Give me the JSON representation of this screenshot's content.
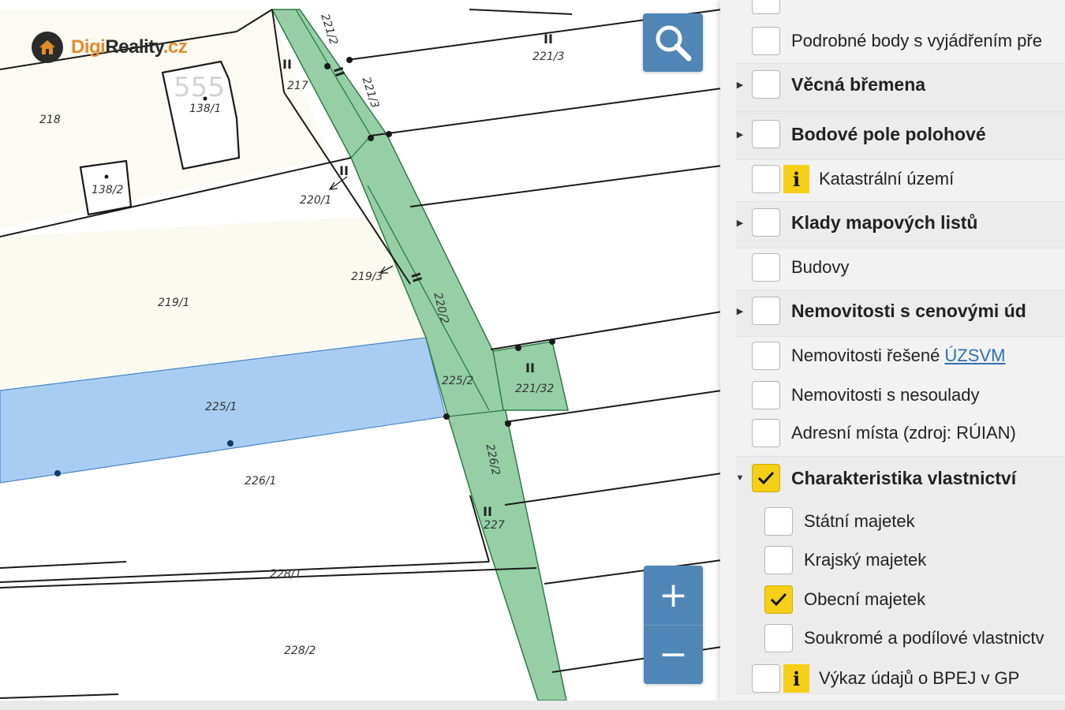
{
  "brand": {
    "part1": "Digi",
    "part2": "Reality",
    "part3": ".cz",
    "accent_color": "#e58c2a"
  },
  "map": {
    "highlight_colors": {
      "municipal_parcel": "#96cfa6",
      "selected_parcel": "#a9cdf2"
    },
    "parcels": [
      {
        "id": "p-221-2",
        "label": "221/2"
      },
      {
        "id": "p-221-3",
        "label": "221/3"
      },
      {
        "id": "p-221-3b",
        "label": "221/3"
      },
      {
        "id": "p-217",
        "label": "217"
      },
      {
        "id": "p-555",
        "label": "555"
      },
      {
        "id": "p-138-1",
        "label": "138/1"
      },
      {
        "id": "p-218",
        "label": "218"
      },
      {
        "id": "p-138-2",
        "label": "138/2"
      },
      {
        "id": "p-220-1",
        "label": "220/1"
      },
      {
        "id": "p-219-3",
        "label": "219/3"
      },
      {
        "id": "p-219-1",
        "label": "219/1"
      },
      {
        "id": "p-220-2",
        "label": "220/2"
      },
      {
        "id": "p-225-2",
        "label": "225/2"
      },
      {
        "id": "p-221-32",
        "label": "221/32"
      },
      {
        "id": "p-225-1",
        "label": "225/1"
      },
      {
        "id": "p-226-2",
        "label": "226/2"
      },
      {
        "id": "p-226-1",
        "label": "226/1"
      },
      {
        "id": "p-227",
        "label": "227"
      },
      {
        "id": "p-228-1",
        "label": "228/1"
      },
      {
        "id": "p-228-2",
        "label": "228/2"
      }
    ],
    "marks": {
      "road": "II"
    },
    "buttons": {
      "search_icon": "search-icon",
      "zoom_in": "+",
      "zoom_out": "−"
    }
  },
  "panel": {
    "layers": [
      {
        "id": "podrobne-body",
        "label": "Podrobné body s vyjádřením pře",
        "checked": false
      },
      {
        "id": "vecna-bremena",
        "label": "Věcná břemena",
        "checked": false
      },
      {
        "id": "bodove-pole",
        "label": "Bodové pole polohové",
        "checked": false
      },
      {
        "id": "katastralni-uzemi",
        "label": "Katastrální území",
        "checked": false
      },
      {
        "id": "klady-listu",
        "label": "Klady mapových listů",
        "checked": false
      },
      {
        "id": "budovy",
        "label": "Budovy",
        "checked": false
      },
      {
        "id": "cenove-udaje",
        "label": "Nemovitosti s cenovými úd",
        "checked": false
      },
      {
        "id": "uzsvm",
        "label_before": "Nemovitosti řešené ",
        "label_link": "ÚZSVM",
        "checked": false
      },
      {
        "id": "nesoulady",
        "label": "Nemovitosti s nesoulady",
        "checked": false
      },
      {
        "id": "adresni-mista",
        "label": "Adresní místa (zdroj: RÚIAN)",
        "checked": false
      },
      {
        "id": "charakteristika",
        "label": "Charakteristika vlastnictví",
        "checked": true
      },
      {
        "id": "statni",
        "label": "Státní majetek",
        "checked": false
      },
      {
        "id": "krajsky",
        "label": "Krajský majetek",
        "checked": false
      },
      {
        "id": "obecni",
        "label": "Obecní majetek",
        "checked": true
      },
      {
        "id": "soukrome",
        "label": "Soukromé a podílové vlastnictv",
        "checked": false
      },
      {
        "id": "bpej",
        "label": "Výkaz údajů o BPEJ v GP",
        "checked": false
      }
    ],
    "info_glyph": "i"
  }
}
